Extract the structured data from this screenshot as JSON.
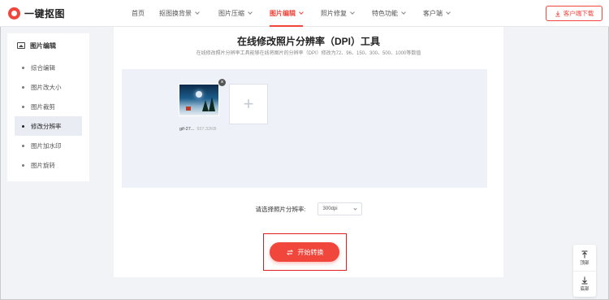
{
  "header": {
    "logo_text": "一键抠图",
    "nav": [
      {
        "label": "首页",
        "has_dropdown": false,
        "active": false
      },
      {
        "label": "抠图换背景",
        "has_dropdown": true,
        "active": false
      },
      {
        "label": "图片压缩",
        "has_dropdown": true,
        "active": false
      },
      {
        "label": "图片编辑",
        "has_dropdown": true,
        "active": true
      },
      {
        "label": "照片修复",
        "has_dropdown": true,
        "active": false
      },
      {
        "label": "特色功能",
        "has_dropdown": true,
        "active": false
      },
      {
        "label": "客户端",
        "has_dropdown": true,
        "active": false
      }
    ],
    "download_label": "客户端下载"
  },
  "sidebar": {
    "title": "图片编辑",
    "items": [
      {
        "label": "综合编辑",
        "active": false
      },
      {
        "label": "图片改大小",
        "active": false
      },
      {
        "label": "图片裁剪",
        "active": false
      },
      {
        "label": "修改分辨率",
        "active": true
      },
      {
        "label": "图片加水印",
        "active": false
      },
      {
        "label": "图片旋转",
        "active": false
      }
    ]
  },
  "main": {
    "title": "在线修改照片分辨率（DPI）工具",
    "subtitle": "在线修改照片分辨率工具能够在线将图片的分辨率（DPI）修改为72、96、150、300、500、1000等数值",
    "file": {
      "name": "gif-27...",
      "size": "937.32KB"
    },
    "dpi_label": "请选择照片分辨率:",
    "dpi_value": "300dpi",
    "start_label": "开始转换"
  },
  "float_bar": {
    "top_label": "顶部",
    "bottom_label": "底部"
  },
  "colors": {
    "accent": "#f0463c",
    "highlight_outline": "#e02020",
    "upload_bg": "#eef1f7",
    "page_bg": "#f2f3f6"
  }
}
